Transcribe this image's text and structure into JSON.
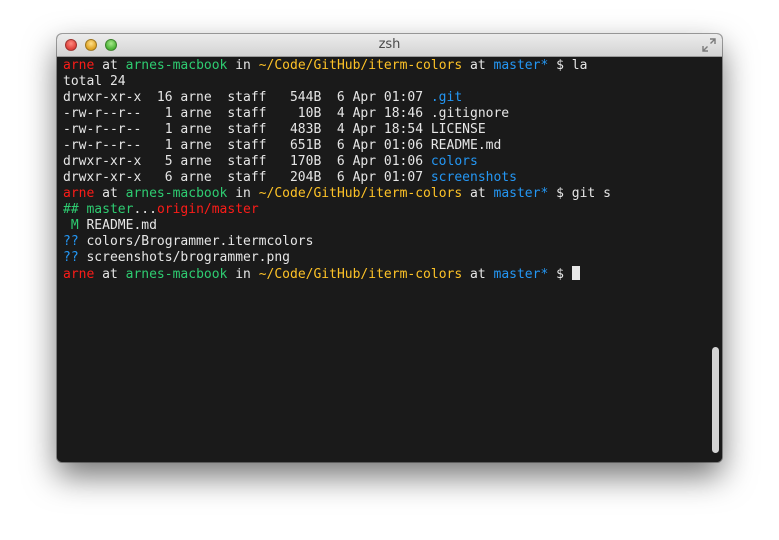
{
  "window": {
    "title": "zsh"
  },
  "prompt": {
    "user": "arne",
    "at": " at ",
    "host": "arnes-macbook",
    "in": " in ",
    "path": "~/Code/GitHub/iterm-colors",
    "at2": " at ",
    "branch": "master*",
    "symbol": " $ "
  },
  "commands": {
    "first": "la",
    "second": "git s"
  },
  "ls_output": {
    "total": "total 24",
    "rows": [
      {
        "meta": "drwxr-xr-x  16 arne  staff   544B  6 Apr 01:07 ",
        "name": ".git"
      },
      {
        "meta": "-rw-r--r--   1 arne  staff    10B  4 Apr 18:46 ",
        "name": ".gitignore"
      },
      {
        "meta": "-rw-r--r--   1 arne  staff   483B  4 Apr 18:54 ",
        "name": "LICENSE"
      },
      {
        "meta": "-rw-r--r--   1 arne  staff   651B  6 Apr 01:06 ",
        "name": "README.md"
      },
      {
        "meta": "drwxr-xr-x   5 arne  staff   170B  6 Apr 01:06 ",
        "name": "colors"
      },
      {
        "meta": "drwxr-xr-x   6 arne  staff   204B  6 Apr 01:07 ",
        "name": "screenshots"
      }
    ]
  },
  "git_status": {
    "branch_marker": "##",
    "local_branch": "master",
    "dots": "...",
    "remote_branch": "origin/master",
    "modified_flag": " M",
    "modified_file": "README.md",
    "untracked_flag": "??",
    "untracked_1": "colors/Brogrammer.itermcolors",
    "untracked_2": "screenshots/brogrammer.png"
  },
  "colors": {
    "red": "#fc1c18",
    "green": "#2ecc71",
    "yellow": "#fdc227",
    "blue": "#2497f4",
    "foreground": "#e6e6e6",
    "background": "#1a1a1a"
  }
}
